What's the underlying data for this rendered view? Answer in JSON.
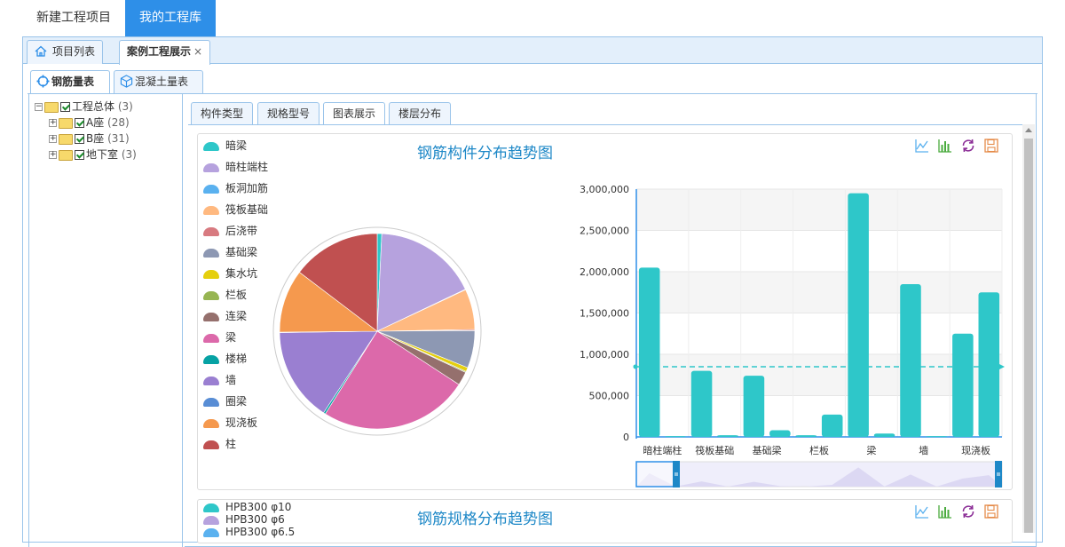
{
  "top_tabs": {
    "new_project": "新建工程项目",
    "my_library": "我的工程库"
  },
  "page_tabs": {
    "project_list": "项目列表",
    "case_display": "案例工程展示",
    "close": "×"
  },
  "sub_tabs": {
    "rebar": "钢筋量表",
    "concrete": "混凝土量表"
  },
  "tree": {
    "root": {
      "label": "工程总体",
      "count": "(3)"
    },
    "children": [
      {
        "label": "A座",
        "count": "(28)"
      },
      {
        "label": "B座",
        "count": "(31)"
      },
      {
        "label": "地下室",
        "count": "(3)"
      }
    ]
  },
  "content_tabs": {
    "type": "构件类型",
    "spec": "规格型号",
    "chart": "图表展示",
    "floor": "楼层分布"
  },
  "panel1": {
    "title": "钢筋构件分布趋势图",
    "legend": [
      {
        "name": "暗梁",
        "color": "#2ec7c9"
      },
      {
        "name": "暗柱端柱",
        "color": "#b6a2de"
      },
      {
        "name": "板洞加筋",
        "color": "#5ab1ef"
      },
      {
        "name": "筏板基础",
        "color": "#ffb980"
      },
      {
        "name": "后浇带",
        "color": "#d87a80"
      },
      {
        "name": "基础梁",
        "color": "#8d98b3"
      },
      {
        "name": "集水坑",
        "color": "#e5cf0d"
      },
      {
        "name": "栏板",
        "color": "#97b552"
      },
      {
        "name": "连梁",
        "color": "#95706d"
      },
      {
        "name": "梁",
        "color": "#dc69aa"
      },
      {
        "name": "楼梯",
        "color": "#07a2a4"
      },
      {
        "name": "墙",
        "color": "#9a7fd1"
      },
      {
        "name": "圈梁",
        "color": "#588dd5"
      },
      {
        "name": "现浇板",
        "color": "#f5994e"
      },
      {
        "name": "柱",
        "color": "#c05050"
      }
    ]
  },
  "panel2": {
    "title": "钢筋规格分布趋势图",
    "legend": [
      {
        "name": "HPB300 φ10",
        "color": "#2ec7c9"
      },
      {
        "name": "HPB300 φ6",
        "color": "#b6a2de"
      },
      {
        "name": "HPB300 φ6.5",
        "color": "#5ab1ef"
      }
    ]
  },
  "icons": [
    "line-chart-icon",
    "bar-chart-icon",
    "refresh-icon",
    "save-icon"
  ],
  "chart_data": [
    {
      "type": "pie",
      "categories": [
        "暗梁",
        "暗柱端柱",
        "板洞加筋",
        "筏板基础",
        "后浇带",
        "基础梁",
        "集水坑",
        "栏板",
        "连梁",
        "梁",
        "楼梯",
        "墙",
        "圈梁",
        "现浇板",
        "柱"
      ],
      "values": [
        90000,
        2050000,
        10000,
        800000,
        20000,
        740000,
        80000,
        20000,
        270000,
        2950000,
        40000,
        1850000,
        10000,
        1250000,
        1750000
      ],
      "colors": [
        "#2ec7c9",
        "#b6a2de",
        "#5ab1ef",
        "#ffb980",
        "#d87a80",
        "#8d98b3",
        "#e5cf0d",
        "#97b552",
        "#95706d",
        "#dc69aa",
        "#07a2a4",
        "#9a7fd1",
        "#588dd5",
        "#f5994e",
        "#c05050"
      ]
    },
    {
      "type": "bar",
      "categories": [
        "暗柱端柱",
        "板洞加筋",
        "筏板基础",
        "后浇带",
        "基础梁",
        "集水坑",
        "栏板",
        "连梁",
        "梁",
        "楼梯",
        "墙",
        "圈梁",
        "现浇板",
        "柱"
      ],
      "values": [
        2050000,
        10000,
        800000,
        20000,
        740000,
        80000,
        20000,
        270000,
        2950000,
        40000,
        1850000,
        10000,
        1250000,
        1750000
      ],
      "tick_labels": [
        "暗柱端柱",
        "筏板基础",
        "基础梁",
        "栏板",
        "梁",
        "墙",
        "现浇板"
      ],
      "ylim": [
        0,
        3000000
      ],
      "yticks": [
        "0",
        "500,000",
        "1,000,000",
        "1,500,000",
        "2,000,000",
        "2,500,000",
        "3,000,000"
      ],
      "average": 850000,
      "color": "#2ec7c9"
    }
  ]
}
